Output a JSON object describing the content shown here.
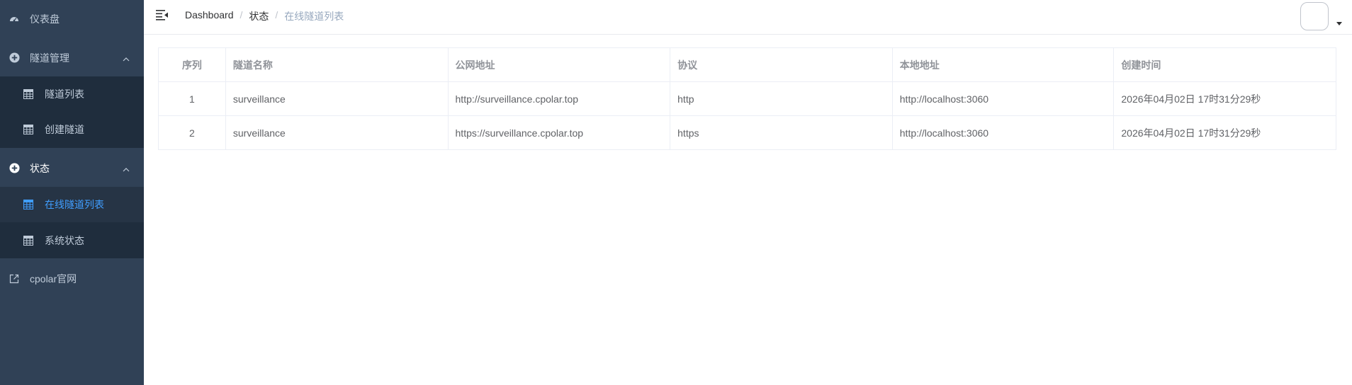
{
  "sidebar": {
    "dashboard_label": "仪表盘",
    "tunnel_mgmt_label": "隧道管理",
    "tunnel_list_label": "隧道列表",
    "create_tunnel_label": "创建隧道",
    "status_label": "状态",
    "online_tunnels_label": "在线隧道列表",
    "system_status_label": "系统状态",
    "cpolar_site_label": "cpolar官网"
  },
  "breadcrumb": {
    "home": "Dashboard",
    "separator": "/",
    "section": "状态",
    "current": "在线隧道列表"
  },
  "table": {
    "headers": [
      "序列",
      "隧道名称",
      "公网地址",
      "协议",
      "本地地址",
      "创建时间"
    ],
    "rows": [
      [
        "1",
        "surveillance",
        "http://surveillance.cpolar.top",
        "http",
        "http://localhost:3060",
        "2026年04月02日 17时31分29秒"
      ],
      [
        "2",
        "surveillance",
        "https://surveillance.cpolar.top",
        "https",
        "http://localhost:3060",
        "2026年04月02日 17时31分29秒"
      ]
    ]
  },
  "colors": {
    "sidebar_bg": "#304156",
    "submenu_bg": "#1f2d3d",
    "active_color": "#409eff",
    "menu_text": "#bfcbd9"
  },
  "icons": {
    "dashboard": "dashboard-icon",
    "tunnel_mgmt": "plus-circle-icon",
    "grid": "table-icon",
    "external": "external-link-icon",
    "hamburger": "hamburger-icon"
  }
}
